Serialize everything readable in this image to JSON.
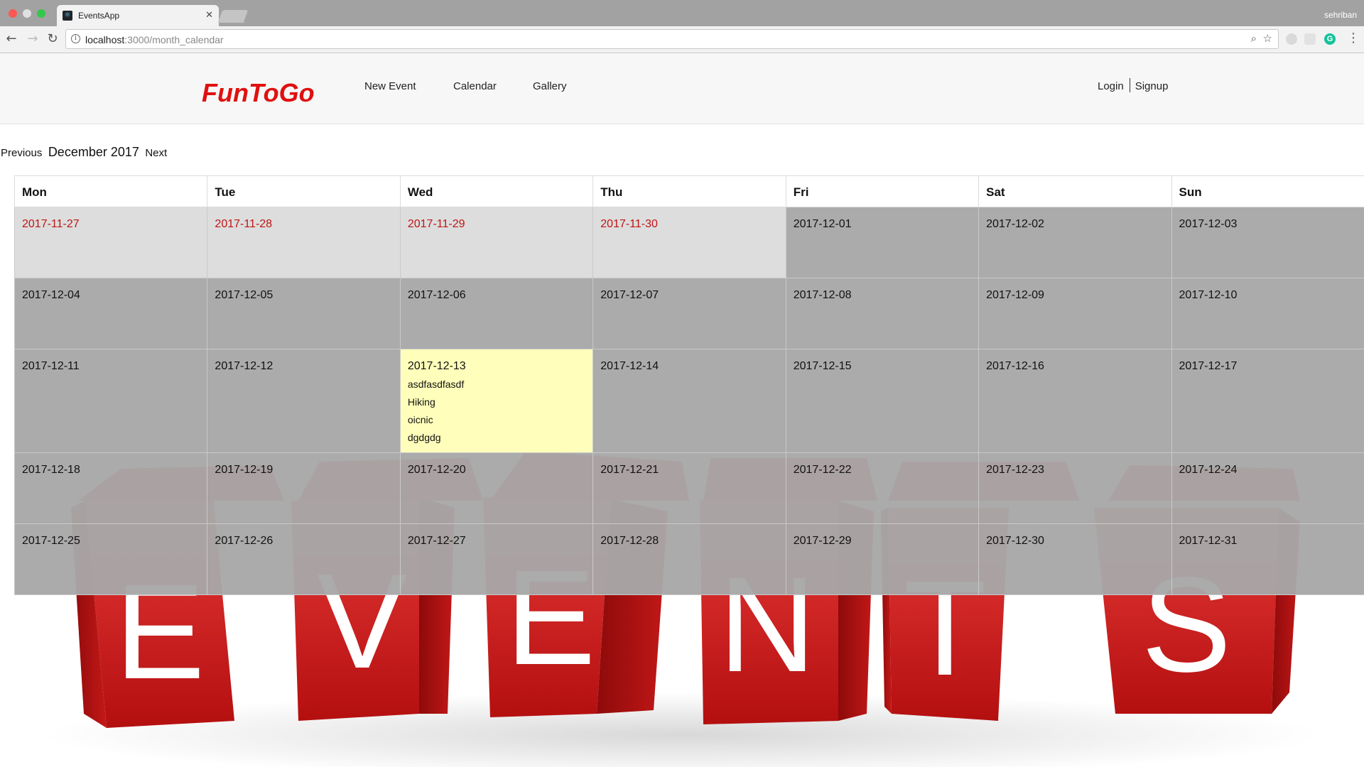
{
  "browser": {
    "tab_title": "EventsApp",
    "profile": "sehriban",
    "url_host": "localhost",
    "url_path": ":3000/month_calendar",
    "icons": [
      "back-icon",
      "forward-icon",
      "reload-icon",
      "info-icon",
      "zoom-icon",
      "star-icon",
      "more-menu-icon"
    ]
  },
  "navbar": {
    "brand": "FunToGo",
    "links": [
      "New Event",
      "Calendar",
      "Gallery"
    ],
    "login": "Login",
    "signup": "Signup",
    "brand_color": "#e01010"
  },
  "calendar": {
    "previous": "Previous",
    "month_label": "December 2017",
    "next": "Next",
    "weekdays": [
      "Mon",
      "Tue",
      "Wed",
      "Thu",
      "Fri",
      "Sat",
      "Sun"
    ],
    "weeks": [
      [
        {
          "date": "2017-11-27",
          "type": "other"
        },
        {
          "date": "2017-11-28",
          "type": "other"
        },
        {
          "date": "2017-11-29",
          "type": "other"
        },
        {
          "date": "2017-11-30",
          "type": "other"
        },
        {
          "date": "2017-12-01",
          "type": "current"
        },
        {
          "date": "2017-12-02",
          "type": "current"
        },
        {
          "date": "2017-12-03",
          "type": "current"
        }
      ],
      [
        {
          "date": "2017-12-04",
          "type": "current"
        },
        {
          "date": "2017-12-05",
          "type": "current"
        },
        {
          "date": "2017-12-06",
          "type": "current"
        },
        {
          "date": "2017-12-07",
          "type": "current"
        },
        {
          "date": "2017-12-08",
          "type": "current"
        },
        {
          "date": "2017-12-09",
          "type": "current"
        },
        {
          "date": "2017-12-10",
          "type": "current"
        }
      ],
      [
        {
          "date": "2017-12-11",
          "type": "current"
        },
        {
          "date": "2017-12-12",
          "type": "current"
        },
        {
          "date": "2017-12-13",
          "type": "today",
          "events": [
            "asdfasdfasdf",
            "Hiking",
            "oicnic",
            "dgdgdg"
          ]
        },
        {
          "date": "2017-12-14",
          "type": "current"
        },
        {
          "date": "2017-12-15",
          "type": "current"
        },
        {
          "date": "2017-12-16",
          "type": "current"
        },
        {
          "date": "2017-12-17",
          "type": "current"
        }
      ],
      [
        {
          "date": "2017-12-18",
          "type": "current"
        },
        {
          "date": "2017-12-19",
          "type": "current"
        },
        {
          "date": "2017-12-20",
          "type": "current"
        },
        {
          "date": "2017-12-21",
          "type": "current"
        },
        {
          "date": "2017-12-22",
          "type": "current"
        },
        {
          "date": "2017-12-23",
          "type": "current"
        },
        {
          "date": "2017-12-24",
          "type": "current"
        }
      ],
      [
        {
          "date": "2017-12-25",
          "type": "current"
        },
        {
          "date": "2017-12-26",
          "type": "current"
        },
        {
          "date": "2017-12-27",
          "type": "current"
        },
        {
          "date": "2017-12-28",
          "type": "current"
        },
        {
          "date": "2017-12-29",
          "type": "current"
        },
        {
          "date": "2017-12-30",
          "type": "current"
        },
        {
          "date": "2017-12-31",
          "type": "current"
        }
      ]
    ],
    "colors": {
      "other_month_text": "#c01414",
      "today_bg": "#ffffbb",
      "current_bg": "#a8a8a8",
      "other_bg": "#dcdcdc"
    }
  },
  "background": {
    "letters": [
      "E",
      "V",
      "E",
      "N",
      "T",
      "S"
    ],
    "cube_color": "#d21f1f"
  }
}
